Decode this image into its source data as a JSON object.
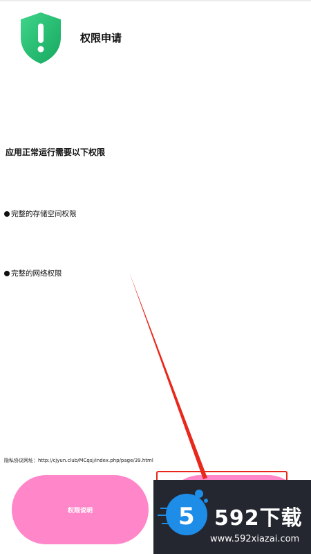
{
  "header": {
    "title": "权限申请",
    "icon": "shield-exclamation-icon"
  },
  "content": {
    "subtitle": "应用正常运行需要以下权限",
    "permissions": [
      {
        "label": "完整的存储空间权限"
      },
      {
        "label": "完整的网络权限"
      }
    ],
    "privacy": "隐私协议网址：http://cjyun.club/MCqsj/index.php/page/39.html"
  },
  "buttons": {
    "explain_label": "权限说明",
    "confirm_label": ""
  },
  "watermark": {
    "logo": "592下载",
    "url": "www.592xiazai.com"
  },
  "colors": {
    "button": "#ff86c8",
    "shield_green": "#1fbf72",
    "annotation_red": "#e8281c",
    "watermark_bg": "#242730"
  }
}
